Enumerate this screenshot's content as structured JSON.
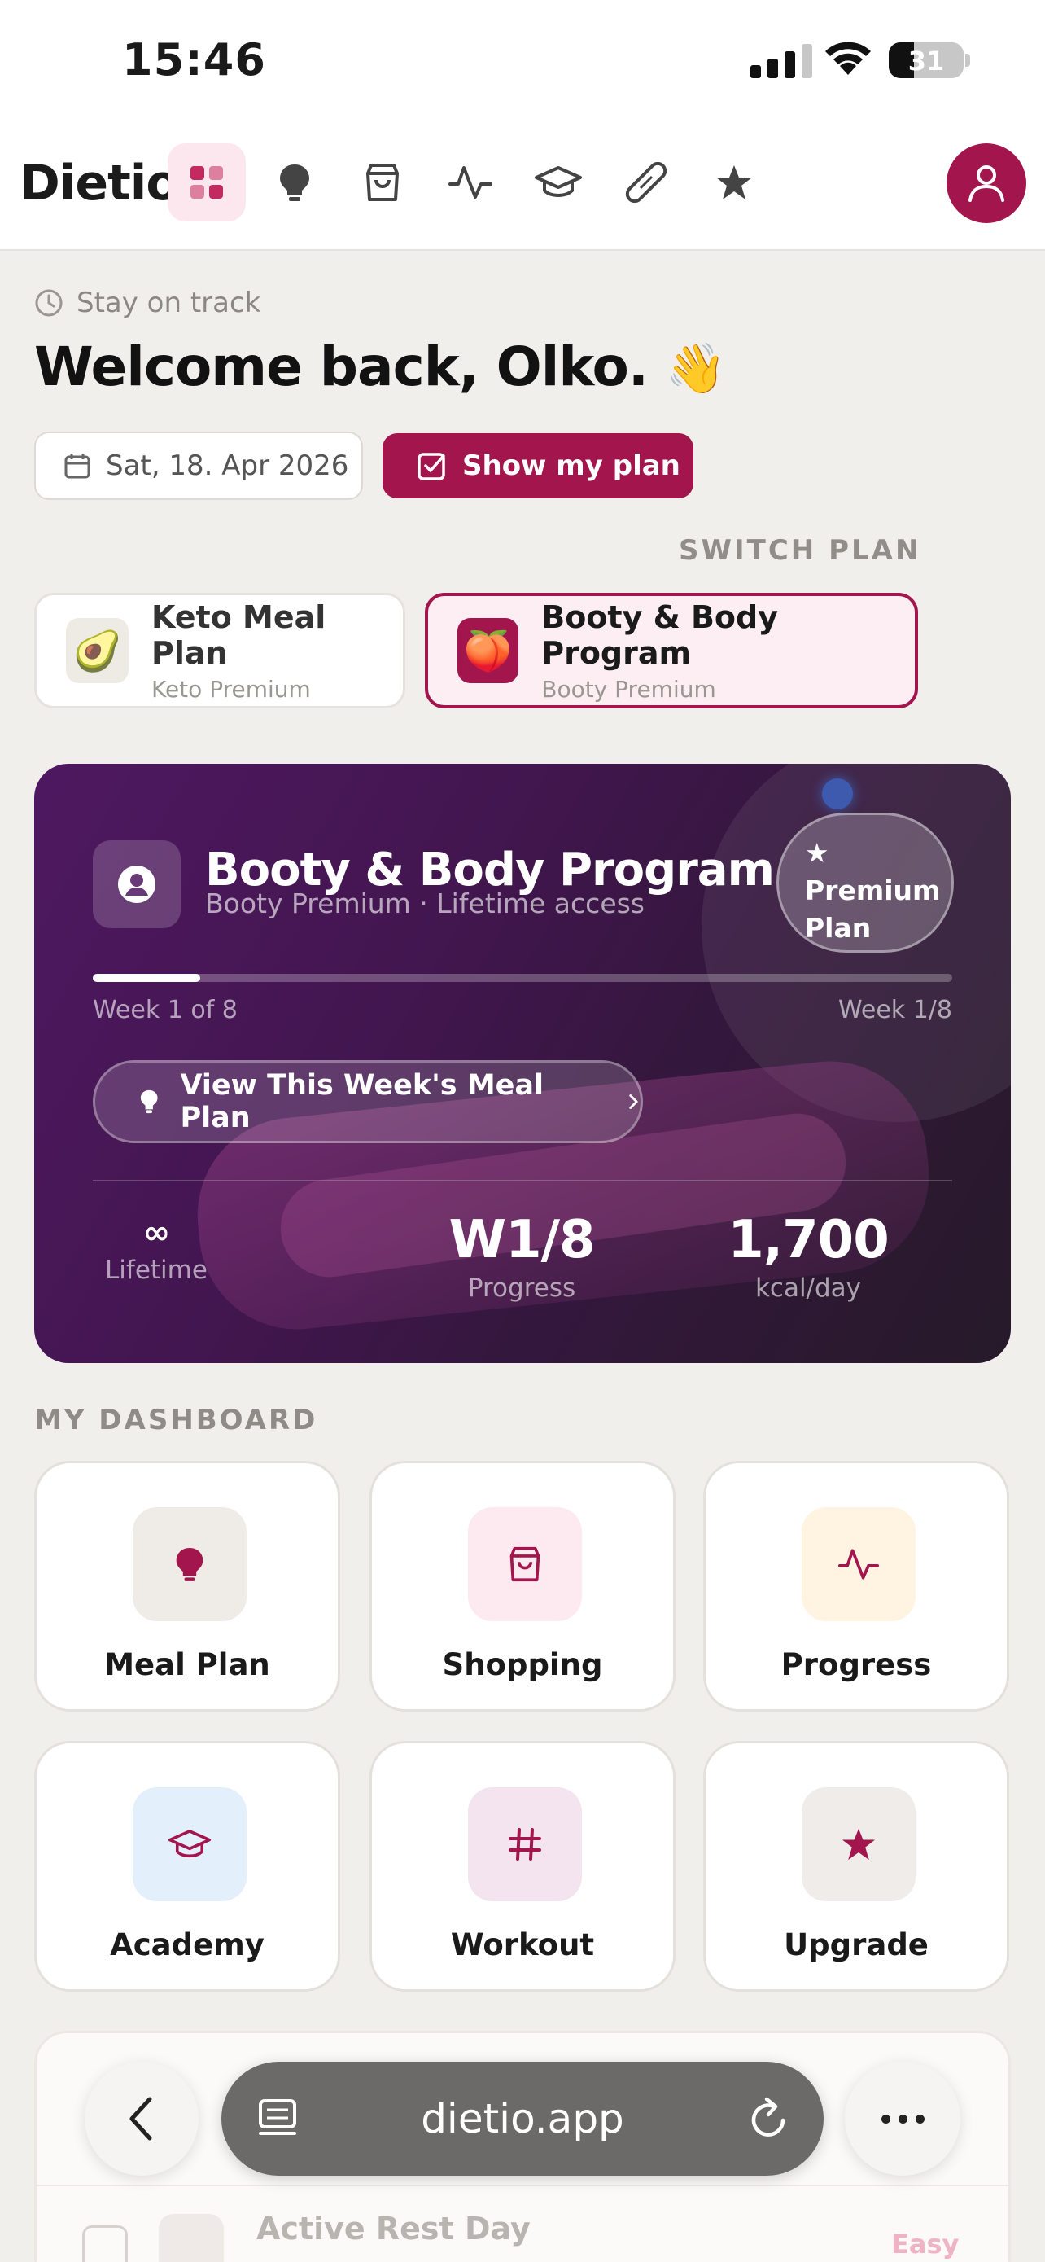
{
  "status_bar": {
    "time": "15:46",
    "battery": "31"
  },
  "nav": {
    "brand": "Dietio",
    "icons": [
      "dashboard-icon",
      "lightbulb-icon",
      "shopping-bag-icon",
      "activity-icon",
      "graduation-cap-icon",
      "bandage-icon",
      "star-icon"
    ],
    "active": "dashboard-icon",
    "profile_icon": "user-icon"
  },
  "header": {
    "eyebrow": "Stay on track",
    "welcome": "Welcome back, Olko.",
    "welcome_emoji": "👋",
    "date": "Sat, 18. Apr 2026",
    "show_plan": "Show my plan",
    "switch_plan": "SWITCH PLAN"
  },
  "plans": [
    {
      "name": "Keto Meal Plan",
      "sub": "Keto Premium",
      "emoji": "🥑",
      "selected": false
    },
    {
      "name": "Booty & Body Program",
      "sub": "Booty Premium",
      "emoji": "🍑",
      "selected": true
    }
  ],
  "hero": {
    "title": "Booty & Body Program",
    "subtitle": "Booty Premium · Lifetime access",
    "badge_star": "★",
    "badge_line1": "Premium",
    "badge_line2": "Plan",
    "week_left": "Week 1 of 8",
    "week_right": "Week 1/8",
    "progress_fraction": 0.125,
    "cta": "View This Week's Meal Plan",
    "stats": [
      {
        "value": "∞",
        "label": "Lifetime"
      },
      {
        "value": "W1/8",
        "label": "Progress"
      },
      {
        "value": "1,700",
        "label": "kcal/day"
      }
    ]
  },
  "dashboard": {
    "label": "MY DASHBOARD",
    "tiles": [
      {
        "label": "Meal Plan",
        "icon": "lightbulb-icon",
        "bg": "#efece8"
      },
      {
        "label": "Shopping",
        "icon": "shopping-bag-icon",
        "bg": "#fdeaf0"
      },
      {
        "label": "Progress",
        "icon": "activity-icon",
        "bg": "#fff3e2"
      },
      {
        "label": "Academy",
        "icon": "graduation-cap-icon",
        "bg": "#e3f0fb"
      },
      {
        "label": "Workout",
        "icon": "hash-icon",
        "bg": "#f3e4f0"
      },
      {
        "label": "Upgrade",
        "icon": "star-icon",
        "bg": "#efecea"
      }
    ]
  },
  "today": {
    "item_title": "Active Rest Day",
    "item_tag": "Easy"
  },
  "browser": {
    "url": "dietio.app"
  },
  "colors": {
    "accent": "#a3164d",
    "hero_start": "#4f1861",
    "hero_end": "#261a29"
  }
}
